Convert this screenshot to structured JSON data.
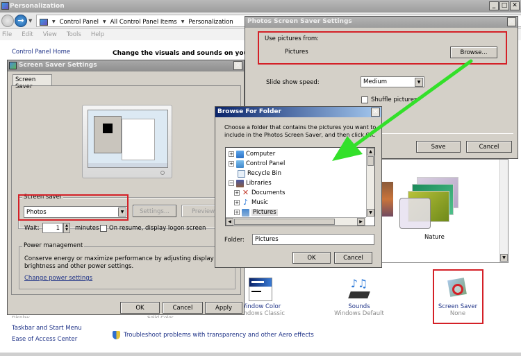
{
  "main_window": {
    "title": "Personalization",
    "controls": {
      "minimize": "_",
      "maximize": "□",
      "close": "✕"
    },
    "breadcrumb": [
      "Control Panel",
      "All Control Panel Items",
      "Personalization"
    ],
    "menu": [
      "File",
      "Edit",
      "View",
      "Tools",
      "Help"
    ],
    "sidebar": {
      "home": "Control Panel Home",
      "see_also": [
        "Display",
        "Taskbar and Start Menu",
        "Ease of Access Center"
      ]
    },
    "heading": "Change the visuals and sounds on your comp",
    "themes": {
      "selected_label": "Nature"
    },
    "bottom_items": [
      {
        "name": "Window Color",
        "sub": "Windows Classic",
        "icon": "window-color-icon"
      },
      {
        "name": "Sounds",
        "sub": "Windows Default",
        "icon": "sounds-icon"
      },
      {
        "name": "Screen Saver",
        "sub": "None",
        "icon": "screen-saver-icon"
      }
    ],
    "desktop_bg_sub": "Solid Color",
    "troubleshoot": "Troubleshoot problems with transparency and other Aero effects"
  },
  "screen_saver_dialog": {
    "title": "Screen Saver Settings",
    "tab": "Screen Saver",
    "group_label": "Screen saver",
    "selected": "Photos",
    "settings_button": "Settings...",
    "preview_button": "Preview",
    "wait_label": "Wait:",
    "wait_value": "1",
    "minutes_label": "minutes",
    "on_resume_label": "On resume, display logon screen",
    "on_resume_checked": false,
    "power_group_label": "Power management",
    "power_desc": "Conserve energy or maximize performance by adjusting display brightness and other power settings.",
    "power_link": "Change power settings",
    "ok": "OK",
    "cancel": "Cancel",
    "apply": "Apply"
  },
  "photos_dialog": {
    "title": "Photos Screen Saver Settings",
    "use_pictures_label": "Use pictures from:",
    "pictures_value": "Pictures",
    "browse_button": "Browse...",
    "speed_label": "Slide show speed:",
    "speed_value": "Medium",
    "shuffle_label": "Shuffle pictures",
    "shuffle_checked": false,
    "save": "Save",
    "cancel": "Cancel"
  },
  "browse_dialog": {
    "title": "Browse For Folder",
    "description": "Choose a folder that contains the pictures you want to include in the Photos Screen Saver, and then click OK.",
    "tree": [
      {
        "label": "Computer",
        "expander": "+",
        "level": 0,
        "icon": "computer-icon"
      },
      {
        "label": "Control Panel",
        "expander": "+",
        "level": 0,
        "icon": "control-panel-icon"
      },
      {
        "label": "Recycle Bin",
        "expander": "",
        "level": 0,
        "icon": "recycle-bin-icon"
      },
      {
        "label": "Libraries",
        "expander": "−",
        "level": 0,
        "icon": "libraries-icon"
      },
      {
        "label": "Documents",
        "expander": "+",
        "level": 1,
        "icon": "documents-icon"
      },
      {
        "label": "Music",
        "expander": "+",
        "level": 1,
        "icon": "music-icon"
      },
      {
        "label": "Pictures",
        "expander": "+",
        "level": 1,
        "icon": "pictures-icon",
        "selected": true
      }
    ],
    "folder_label": "Folder:",
    "folder_value": "Pictures",
    "ok": "OK",
    "cancel": "Cancel"
  },
  "annotations": {
    "highlight_color": "#d42027",
    "arrow_color": "#33e02a"
  }
}
